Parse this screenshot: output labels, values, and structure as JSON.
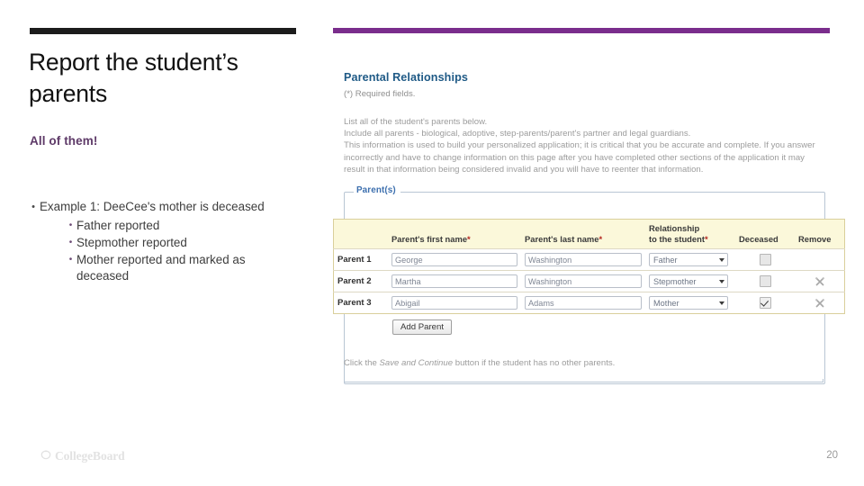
{
  "slide": {
    "title": "Report the student’s parents",
    "subtitle": "All of them!",
    "page_number": "20",
    "accent_bar_color": "#1c1c1c",
    "subtitle_color": "#5e3a68",
    "brand": "CollegeBoard"
  },
  "bullets": {
    "main": "Example 1:  DeeCee's mother is deceased",
    "sub": [
      "Father reported",
      "Stepmother reported",
      "Mother reported and marked as deceased"
    ]
  },
  "form": {
    "accent_bar_color": "#7a2d8c",
    "heading": "Parental Relationships",
    "heading_color": "#1f5a86",
    "required_note": "(*) Required fields.",
    "intro": {
      "line1": "List all of the student's parents below.",
      "line2": "Include all parents - biological, adoptive, step-parents/parent's partner and legal guardians.",
      "line3": "This information is used to build your personalized application; it is critical that you be accurate and complete. If you answer incorrectly and have to change information on this page after you have completed other sections of the application it may result in that information being considered invalid and you will have to reenter that information."
    },
    "fieldset_legend": "Parent(s)",
    "table": {
      "headers": {
        "blank": "",
        "first_name": "Parent's first name",
        "last_name": "Parent's last name",
        "relationship": "Relationship to the student",
        "relationship_line1": "Relationship",
        "relationship_line2": "to the student",
        "deceased": "Deceased",
        "remove": "Remove"
      },
      "required_marker": "*",
      "rows": [
        {
          "label": "Parent 1",
          "first_name": "George",
          "last_name": "Washington",
          "relationship": "Father",
          "deceased": false,
          "removable": false
        },
        {
          "label": "Parent 2",
          "first_name": "Martha",
          "last_name": "Washington",
          "relationship": "Stepmother",
          "deceased": false,
          "removable": true
        },
        {
          "label": "Parent 3",
          "first_name": "Abigail",
          "last_name": "Adams",
          "relationship": "Mother",
          "deceased": true,
          "removable": true
        }
      ]
    },
    "add_parent_label": "Add Parent",
    "save_hint": {
      "prefix": "Click the ",
      "emphasis": "Save and Continue",
      "suffix": " button if the student has no other parents."
    }
  }
}
